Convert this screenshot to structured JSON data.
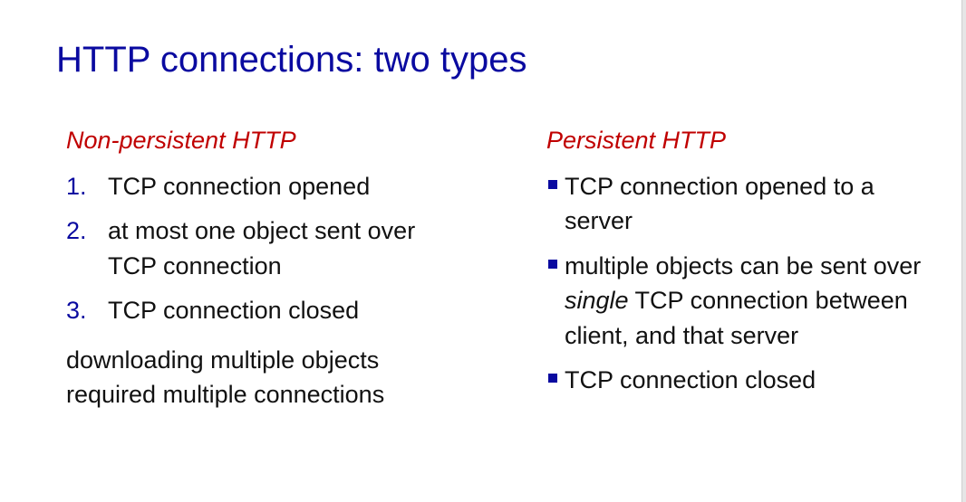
{
  "title": "HTTP connections: two types",
  "left": {
    "heading": "Non-persistent HTTP",
    "items": [
      {
        "num": "1.",
        "text": "TCP connection opened"
      },
      {
        "num": "2.",
        "text": "at most one object sent over TCP connection"
      },
      {
        "num": "3.",
        "text": "TCP connection closed"
      }
    ],
    "note": "downloading multiple objects required multiple connections"
  },
  "right": {
    "heading": "Persistent HTTP",
    "item1": "TCP connection opened to a server",
    "item2_pre": "multiple objects can be sent over ",
    "item2_em": "single",
    "item2_post": " TCP connection between client, and that server",
    "item3": "TCP connection closed"
  },
  "colors": {
    "title": "#0a0aa0",
    "heading": "#c00000"
  }
}
